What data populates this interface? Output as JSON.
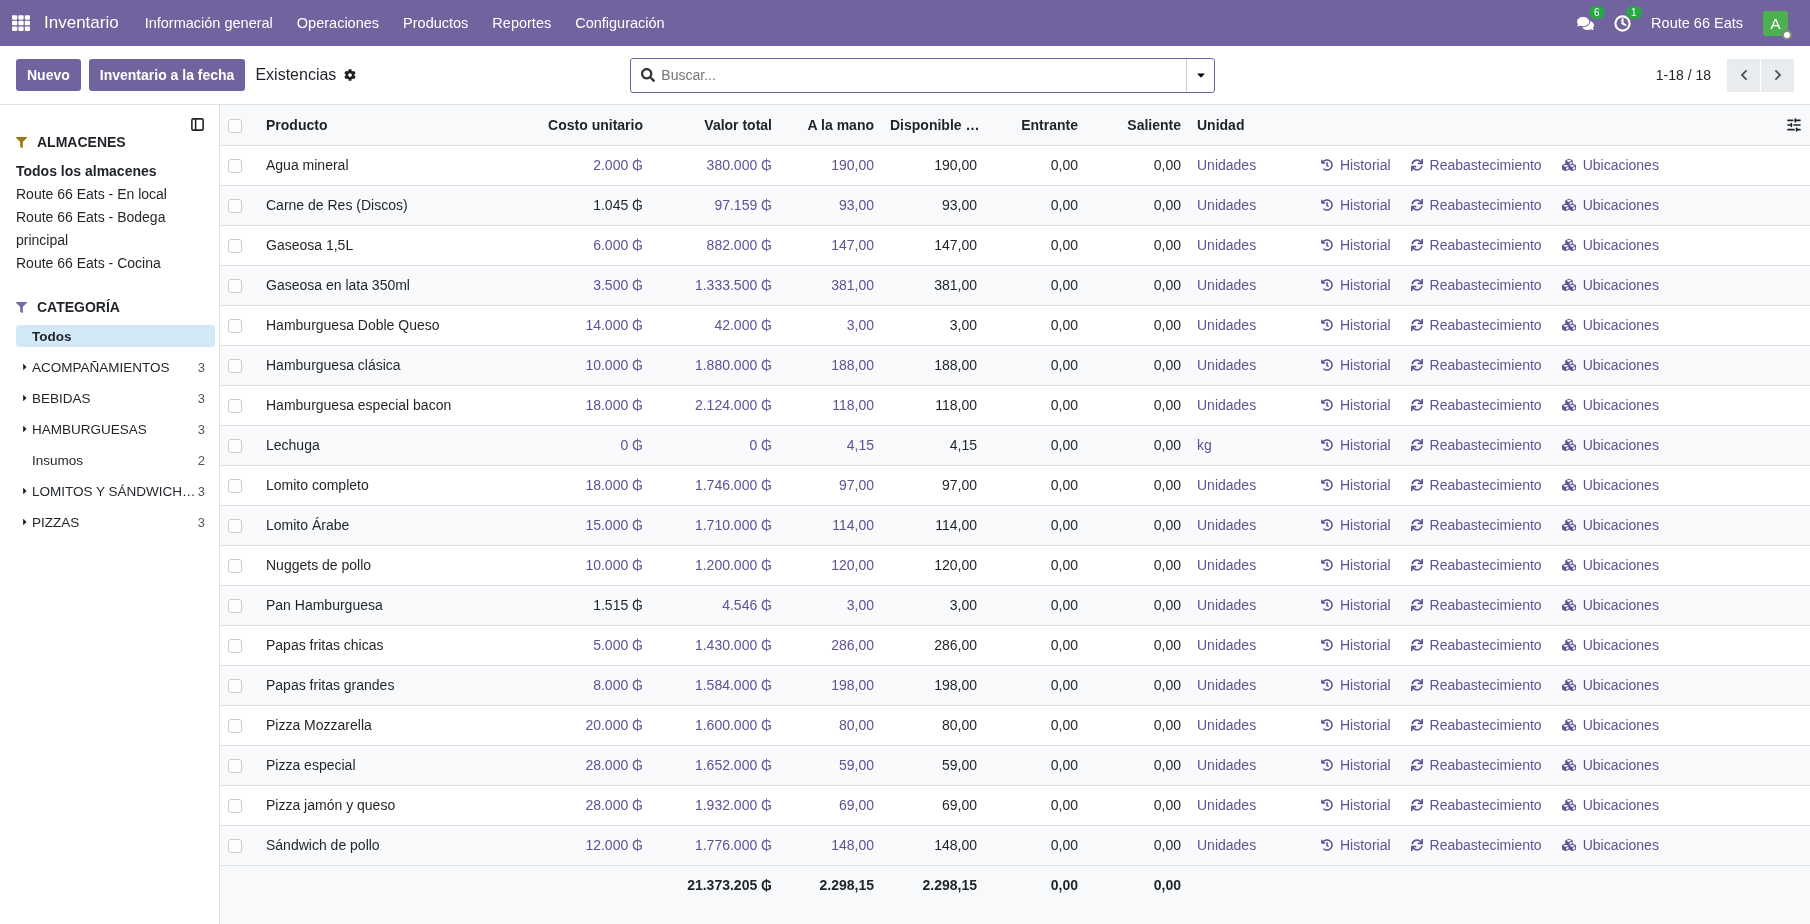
{
  "navbar": {
    "app_name": "Inventario",
    "menus": [
      "Información general",
      "Operaciones",
      "Productos",
      "Reportes",
      "Configuración"
    ],
    "messages_badge": "6",
    "activities_badge": "1",
    "company": "Route 66 Eats",
    "avatar_letter": "A"
  },
  "control_panel": {
    "buttons": [
      "Nuevo",
      "Inventario a la fecha"
    ],
    "title": "Existencias",
    "search": {
      "placeholder": "Buscar..."
    },
    "pager": "1-18 / 18"
  },
  "sidebar": {
    "sections": [
      {
        "title": "ALMACENES",
        "color": "#9a7b10",
        "items": [
          {
            "label": "Todos los almacenes",
            "selected": true
          },
          {
            "label": "Route 66 Eats - En local",
            "selected": false
          },
          {
            "label": "Route 66 Eats - Bodega principal",
            "selected": false
          },
          {
            "label": "Route 66 Eats - Cocina",
            "selected": false
          }
        ]
      },
      {
        "title": "CATEGORÍA",
        "color": "#7a6aa8",
        "items": [
          {
            "label": "Todos",
            "selected": true,
            "has_children": false
          },
          {
            "label": "ACOMPAÑAMIENTOS",
            "count": "3",
            "selected": false,
            "has_children": true
          },
          {
            "label": "BEBIDAS",
            "count": "3",
            "selected": false,
            "has_children": true
          },
          {
            "label": "HAMBURGUESAS",
            "count": "3",
            "selected": false,
            "has_children": true
          },
          {
            "label": "Insumos",
            "count": "2",
            "selected": false,
            "has_children": false
          },
          {
            "label": "LOMITOS Y SÁNDWICH…",
            "count": "3",
            "selected": false,
            "has_children": true
          },
          {
            "label": "PIZZAS",
            "count": "3",
            "selected": false,
            "has_children": true
          }
        ]
      }
    ]
  },
  "table": {
    "columns": [
      "Producto",
      "Costo unitario",
      "Valor total",
      "A la mano",
      "Disponible …",
      "Entrante",
      "Saliente",
      "Unidad"
    ],
    "header_selected": false,
    "rows": [
      {
        "product": "Agua mineral",
        "cost": "2.000 ₲",
        "cost_link": true,
        "value": "380.000 ₲",
        "on_hand": "190,00",
        "available": "190,00",
        "incoming": "0,00",
        "outgoing": "0,00",
        "unit": "Unidades",
        "selected": false,
        "actions": [
          {
            "kind": "history",
            "label": "Historial"
          },
          {
            "kind": "replenish",
            "label": "Reabastecimiento"
          },
          {
            "kind": "locations",
            "label": "Ubicaciones"
          }
        ]
      },
      {
        "product": "Carne de Res (Discos)",
        "cost": "1.045 ₲",
        "cost_link": false,
        "value": "97.159 ₲",
        "on_hand": "93,00",
        "available": "93,00",
        "incoming": "0,00",
        "outgoing": "0,00",
        "unit": "Unidades",
        "selected": false,
        "actions": [
          {
            "kind": "history",
            "label": "Historial"
          },
          {
            "kind": "replenish",
            "label": "Reabastecimiento"
          },
          {
            "kind": "locations",
            "label": "Ubicaciones"
          }
        ]
      },
      {
        "product": "Gaseosa 1,5L",
        "cost": "6.000 ₲",
        "cost_link": true,
        "value": "882.000 ₲",
        "on_hand": "147,00",
        "available": "147,00",
        "incoming": "0,00",
        "outgoing": "0,00",
        "unit": "Unidades",
        "selected": false,
        "actions": [
          {
            "kind": "history",
            "label": "Historial"
          },
          {
            "kind": "replenish",
            "label": "Reabastecimiento"
          },
          {
            "kind": "locations",
            "label": "Ubicaciones"
          }
        ]
      },
      {
        "product": "Gaseosa en lata 350ml",
        "cost": "3.500 ₲",
        "cost_link": true,
        "value": "1.333.500 ₲",
        "on_hand": "381,00",
        "available": "381,00",
        "incoming": "0,00",
        "outgoing": "0,00",
        "unit": "Unidades",
        "selected": false,
        "actions": [
          {
            "kind": "history",
            "label": "Historial"
          },
          {
            "kind": "replenish",
            "label": "Reabastecimiento"
          },
          {
            "kind": "locations",
            "label": "Ubicaciones"
          }
        ]
      },
      {
        "product": "Hamburguesa Doble Queso",
        "cost": "14.000 ₲",
        "cost_link": true,
        "value": "42.000 ₲",
        "on_hand": "3,00",
        "available": "3,00",
        "incoming": "0,00",
        "outgoing": "0,00",
        "unit": "Unidades",
        "selected": false,
        "actions": [
          {
            "kind": "history",
            "label": "Historial"
          },
          {
            "kind": "replenish",
            "label": "Reabastecimiento"
          },
          {
            "kind": "locations",
            "label": "Ubicaciones"
          }
        ]
      },
      {
        "product": "Hamburguesa clásica",
        "cost": "10.000 ₲",
        "cost_link": true,
        "value": "1.880.000 ₲",
        "on_hand": "188,00",
        "available": "188,00",
        "incoming": "0,00",
        "outgoing": "0,00",
        "unit": "Unidades",
        "selected": false,
        "actions": [
          {
            "kind": "history",
            "label": "Historial"
          },
          {
            "kind": "replenish",
            "label": "Reabastecimiento"
          },
          {
            "kind": "locations",
            "label": "Ubicaciones"
          }
        ]
      },
      {
        "product": "Hamburguesa especial bacon",
        "cost": "18.000 ₲",
        "cost_link": true,
        "value": "2.124.000 ₲",
        "on_hand": "118,00",
        "available": "118,00",
        "incoming": "0,00",
        "outgoing": "0,00",
        "unit": "Unidades",
        "selected": false,
        "actions": [
          {
            "kind": "history",
            "label": "Historial"
          },
          {
            "kind": "replenish",
            "label": "Reabastecimiento"
          },
          {
            "kind": "locations",
            "label": "Ubicaciones"
          }
        ]
      },
      {
        "product": "Lechuga",
        "cost": "0 ₲",
        "cost_link": true,
        "value": "0 ₲",
        "on_hand": "4,15",
        "available": "4,15",
        "incoming": "0,00",
        "outgoing": "0,00",
        "unit": "kg",
        "selected": false,
        "actions": [
          {
            "kind": "history",
            "label": "Historial"
          },
          {
            "kind": "replenish",
            "label": "Reabastecimiento"
          },
          {
            "kind": "locations",
            "label": "Ubicaciones"
          }
        ]
      },
      {
        "product": "Lomito completo",
        "cost": "18.000 ₲",
        "cost_link": true,
        "value": "1.746.000 ₲",
        "on_hand": "97,00",
        "available": "97,00",
        "incoming": "0,00",
        "outgoing": "0,00",
        "unit": "Unidades",
        "selected": false,
        "actions": [
          {
            "kind": "history",
            "label": "Historial"
          },
          {
            "kind": "replenish",
            "label": "Reabastecimiento"
          },
          {
            "kind": "locations",
            "label": "Ubicaciones"
          }
        ]
      },
      {
        "product": "Lomito Árabe",
        "cost": "15.000 ₲",
        "cost_link": true,
        "value": "1.710.000 ₲",
        "on_hand": "114,00",
        "available": "114,00",
        "incoming": "0,00",
        "outgoing": "0,00",
        "unit": "Unidades",
        "selected": false,
        "actions": [
          {
            "kind": "history",
            "label": "Historial"
          },
          {
            "kind": "replenish",
            "label": "Reabastecimiento"
          },
          {
            "kind": "locations",
            "label": "Ubicaciones"
          }
        ]
      },
      {
        "product": "Nuggets de pollo",
        "cost": "10.000 ₲",
        "cost_link": true,
        "value": "1.200.000 ₲",
        "on_hand": "120,00",
        "available": "120,00",
        "incoming": "0,00",
        "outgoing": "0,00",
        "unit": "Unidades",
        "selected": false,
        "actions": [
          {
            "kind": "history",
            "label": "Historial"
          },
          {
            "kind": "replenish",
            "label": "Reabastecimiento"
          },
          {
            "kind": "locations",
            "label": "Ubicaciones"
          }
        ]
      },
      {
        "product": "Pan Hamburguesa",
        "cost": "1.515 ₲",
        "cost_link": false,
        "value": "4.546 ₲",
        "on_hand": "3,00",
        "available": "3,00",
        "incoming": "0,00",
        "outgoing": "0,00",
        "unit": "Unidades",
        "selected": false,
        "actions": [
          {
            "kind": "history",
            "label": "Historial"
          },
          {
            "kind": "replenish",
            "label": "Reabastecimiento"
          },
          {
            "kind": "locations",
            "label": "Ubicaciones"
          }
        ]
      },
      {
        "product": "Papas fritas chicas",
        "cost": "5.000 ₲",
        "cost_link": true,
        "value": "1.430.000 ₲",
        "on_hand": "286,00",
        "available": "286,00",
        "incoming": "0,00",
        "outgoing": "0,00",
        "unit": "Unidades",
        "selected": false,
        "actions": [
          {
            "kind": "history",
            "label": "Historial"
          },
          {
            "kind": "replenish",
            "label": "Reabastecimiento"
          },
          {
            "kind": "locations",
            "label": "Ubicaciones"
          }
        ]
      },
      {
        "product": "Papas fritas grandes",
        "cost": "8.000 ₲",
        "cost_link": true,
        "value": "1.584.000 ₲",
        "on_hand": "198,00",
        "available": "198,00",
        "incoming": "0,00",
        "outgoing": "0,00",
        "unit": "Unidades",
        "selected": false,
        "actions": [
          {
            "kind": "history",
            "label": "Historial"
          },
          {
            "kind": "replenish",
            "label": "Reabastecimiento"
          },
          {
            "kind": "locations",
            "label": "Ubicaciones"
          }
        ]
      },
      {
        "product": "Pizza Mozzarella",
        "cost": "20.000 ₲",
        "cost_link": true,
        "value": "1.600.000 ₲",
        "on_hand": "80,00",
        "available": "80,00",
        "incoming": "0,00",
        "outgoing": "0,00",
        "unit": "Unidades",
        "selected": false,
        "actions": [
          {
            "kind": "history",
            "label": "Historial"
          },
          {
            "kind": "replenish",
            "label": "Reabastecimiento"
          },
          {
            "kind": "locations",
            "label": "Ubicaciones"
          }
        ]
      },
      {
        "product": "Pizza especial",
        "cost": "28.000 ₲",
        "cost_link": true,
        "value": "1.652.000 ₲",
        "on_hand": "59,00",
        "available": "59,00",
        "incoming": "0,00",
        "outgoing": "0,00",
        "unit": "Unidades",
        "selected": false,
        "actions": [
          {
            "kind": "history",
            "label": "Historial"
          },
          {
            "kind": "replenish",
            "label": "Reabastecimiento"
          },
          {
            "kind": "locations",
            "label": "Ubicaciones"
          }
        ]
      },
      {
        "product": "Pizza jamón y queso",
        "cost": "28.000 ₲",
        "cost_link": true,
        "value": "1.932.000 ₲",
        "on_hand": "69,00",
        "available": "69,00",
        "incoming": "0,00",
        "outgoing": "0,00",
        "unit": "Unidades",
        "selected": false,
        "actions": [
          {
            "kind": "history",
            "label": "Historial"
          },
          {
            "kind": "replenish",
            "label": "Reabastecimiento"
          },
          {
            "kind": "locations",
            "label": "Ubicaciones"
          }
        ]
      },
      {
        "product": "Sándwich de pollo",
        "cost": "12.000 ₲",
        "cost_link": true,
        "value": "1.776.000 ₲",
        "on_hand": "148,00",
        "available": "148,00",
        "incoming": "0,00",
        "outgoing": "0,00",
        "unit": "Unidades",
        "selected": false,
        "actions": [
          {
            "kind": "history",
            "label": "Historial"
          },
          {
            "kind": "replenish",
            "label": "Reabastecimiento"
          },
          {
            "kind": "locations",
            "label": "Ubicaciones"
          }
        ]
      }
    ],
    "totals": {
      "value": "21.373.205 ₲",
      "on_hand": "2.298,15",
      "available": "2.298,15",
      "incoming": "0,00",
      "outgoing": "0,00"
    }
  }
}
